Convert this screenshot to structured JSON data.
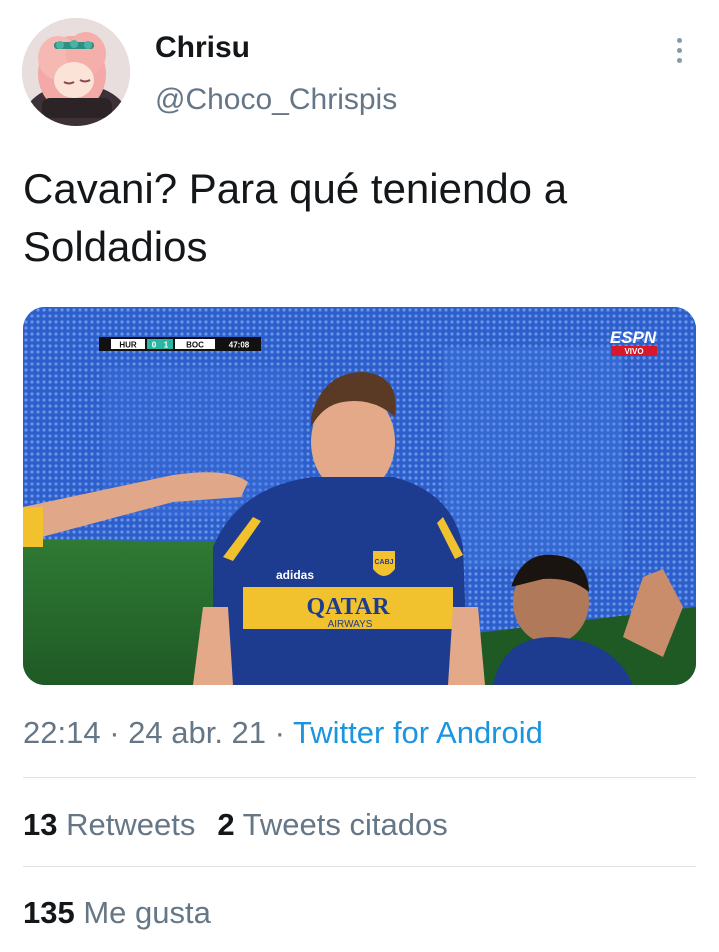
{
  "author": {
    "display_name": "Chrisu",
    "handle": "@Choco_Chrispis"
  },
  "tweet": {
    "text_line1": "Cavani? Para qué teniendo a",
    "text_line2": "Soldadios"
  },
  "media": {
    "scoreboard": {
      "home": "HUR",
      "home_score": "0",
      "away_score": "1",
      "away": "BOC",
      "clock": "47:08"
    },
    "broadcaster": "ESPN",
    "live_label": "VIVO",
    "jersey_sponsor": "QATAR",
    "jersey_sponsor_sub": "AIRWAYS",
    "kit_brand": "adidas",
    "crest": "CABJ"
  },
  "meta": {
    "time": "22:14",
    "separator1": " · ",
    "date": "24 abr. 21",
    "separator2": " · ",
    "source": "Twitter for Android"
  },
  "stats": {
    "retweets_count": "13",
    "retweets_label": "Retweets",
    "quotes_count": "2",
    "quotes_label": "Tweets citados",
    "likes_count": "135",
    "likes_label": "Me gusta"
  },
  "icons": {
    "more": "more-vertical-icon"
  },
  "colors": {
    "link": "#1b95e0",
    "secondary_text": "#657786",
    "primary_text": "#14171a",
    "boca_blue": "#1d3b8f",
    "boca_gold": "#f2c12e"
  }
}
